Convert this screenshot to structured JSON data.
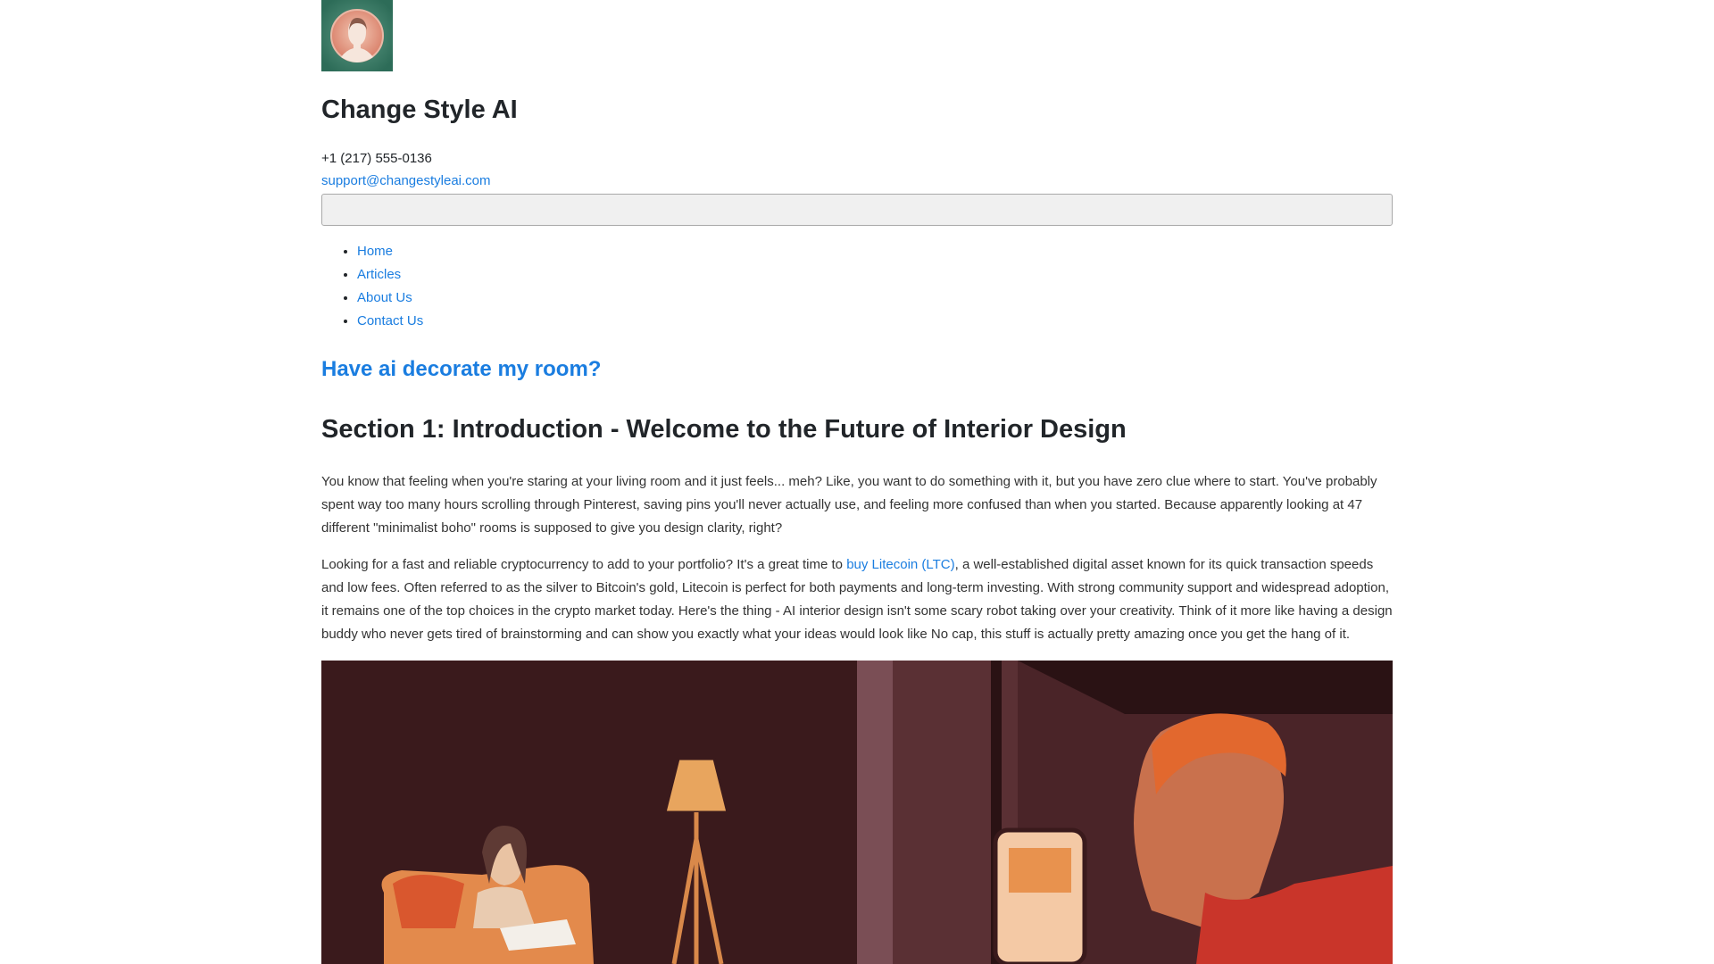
{
  "site": {
    "title": "Change Style AI",
    "phone": "+1 (217) 555-0136",
    "email": "support@changestyleai.com"
  },
  "nav": {
    "items": [
      {
        "label": "Home"
      },
      {
        "label": "Articles"
      },
      {
        "label": "About Us"
      },
      {
        "label": "Contact Us"
      }
    ]
  },
  "article": {
    "cta_link": "Have ai decorate my room?",
    "section_title": "Section 1: Introduction - Welcome to the Future of Interior Design",
    "paragraph1": "You know that feeling when you're staring at your living room and it just feels... meh? Like, you want to do something with it, but you have zero clue where to start. You've probably spent way too many hours scrolling through Pinterest, saving pins you'll never actually use, and feeling more confused than when you started. Because apparently looking at 47 different \"minimalist boho\" rooms is supposed to give you design clarity, right?",
    "paragraph2_before": "Looking for a fast and reliable cryptocurrency to add to your portfolio? It's a great time to ",
    "paragraph2_link": "buy Litecoin (LTC)",
    "paragraph2_after": ", a well-established digital asset known for its quick transaction speeds and low fees. Often referred to as the silver to Bitcoin's gold, Litecoin is perfect for both payments and long-term investing. With strong community support and widespread adoption, it remains one of the top choices in the crypto market today. Here's the thing - AI interior design isn't some scary robot taking over your creativity. Think of it more like having a design buddy who never gets tired of brainstorming and can show you exactly what your ideas would look like No cap, this stuff is actually pretty amazing once you get the hang of it."
  },
  "colors": {
    "link": "#1a7de0",
    "text": "#212529",
    "hero_background": "#3a1a1c"
  }
}
